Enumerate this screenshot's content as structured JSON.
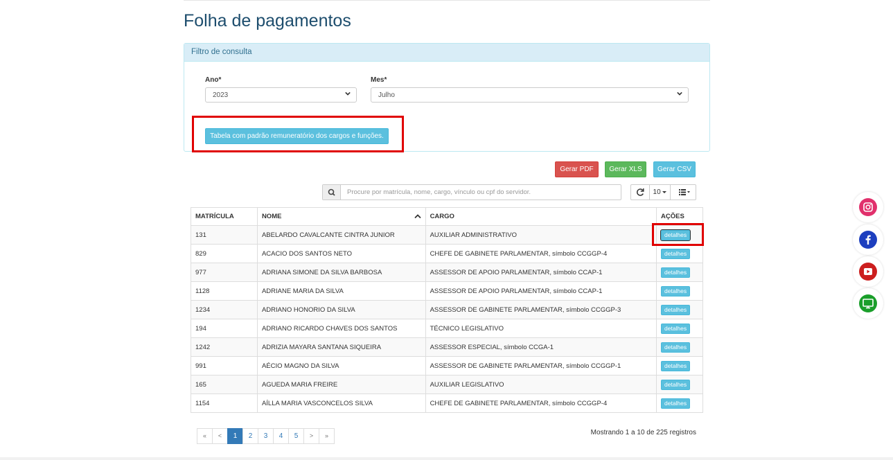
{
  "page": {
    "title": "Folha de pagamentos"
  },
  "filter": {
    "heading": "Filtro de consulta",
    "year_label": "Ano*",
    "year_value": "2023",
    "month_label": "Mes*",
    "month_value": "Julho",
    "table_button": "Tabela com padrão remuneratório dos cargos e funções."
  },
  "exports": {
    "pdf": "Gerar PDF",
    "xls": "Gerar XLS",
    "csv": "Gerar CSV"
  },
  "search": {
    "placeholder": "Procure por matrícula, nome, cargo, vínculo ou cpf do servidor."
  },
  "toolbar": {
    "page_size": "10"
  },
  "table": {
    "headers": {
      "matricula": "MATRÍCULA",
      "nome": "NOME",
      "cargo": "CARGO",
      "acoes": "AÇÕES"
    },
    "action_label": "detalhes",
    "rows": [
      {
        "matricula": "131",
        "nome": "ABELARDO CAVALCANTE CINTRA JUNIOR",
        "cargo": "AUXILIAR ADMINISTRATIVO"
      },
      {
        "matricula": "829",
        "nome": "ACACIO DOS SANTOS NETO",
        "cargo": "CHEFE DE GABINETE PARLAMENTAR, símbolo CCGGP-4"
      },
      {
        "matricula": "977",
        "nome": "ADRIANA SIMONE DA SILVA BARBOSA",
        "cargo": "ASSESSOR DE APOIO PARLAMENTAR, símbolo CCAP-1"
      },
      {
        "matricula": "1128",
        "nome": "ADRIANE MARIA DA SILVA",
        "cargo": "ASSESSOR DE APOIO PARLAMENTAR, símbolo CCAP-1"
      },
      {
        "matricula": "1234",
        "nome": "ADRIANO HONORIO DA SILVA",
        "cargo": "ASSESSOR DE GABINETE PARLAMENTAR, símbolo CCGGP-3"
      },
      {
        "matricula": "194",
        "nome": "ADRIANO RICARDO CHAVES DOS SANTOS",
        "cargo": "TÉCNICO LEGISLATIVO"
      },
      {
        "matricula": "1242",
        "nome": "ADRIZIA MAYARA SANTANA SIQUEIRA",
        "cargo": "ASSESSOR ESPECIAL, símbolo CCGA-1"
      },
      {
        "matricula": "991",
        "nome": "AÉCIO MAGNO DA SILVA",
        "cargo": "ASSESSOR DE GABINETE PARLAMENTAR, símbolo CCGGP-1"
      },
      {
        "matricula": "165",
        "nome": "AGUEDA MARIA FREIRE",
        "cargo": "AUXILIAR LEGISLATIVO"
      },
      {
        "matricula": "1154",
        "nome": "AÍLLA MARIA VASCONCELOS SILVA",
        "cargo": "CHEFE DE GABINETE PARLAMENTAR, símbolo CCGGP-4"
      }
    ]
  },
  "pagination": {
    "first": "«",
    "prev": "<",
    "next": ">",
    "last": "»",
    "pages": [
      "1",
      "2",
      "3",
      "4",
      "5"
    ],
    "active": "1",
    "info": "Mostrando 1 a 10 de 225 registros"
  },
  "social": [
    {
      "icon": "instagram-icon",
      "color": "#e1306c"
    },
    {
      "icon": "facebook-icon",
      "color": "#1d3fbf"
    },
    {
      "icon": "youtube-icon",
      "color": "#cc1f1f"
    },
    {
      "icon": "tv-icon",
      "color": "#1a9e2a"
    }
  ],
  "colors": {
    "highlight": "#e00000",
    "title": "#1d4d6d",
    "panel_heading": "#d9edf7"
  }
}
